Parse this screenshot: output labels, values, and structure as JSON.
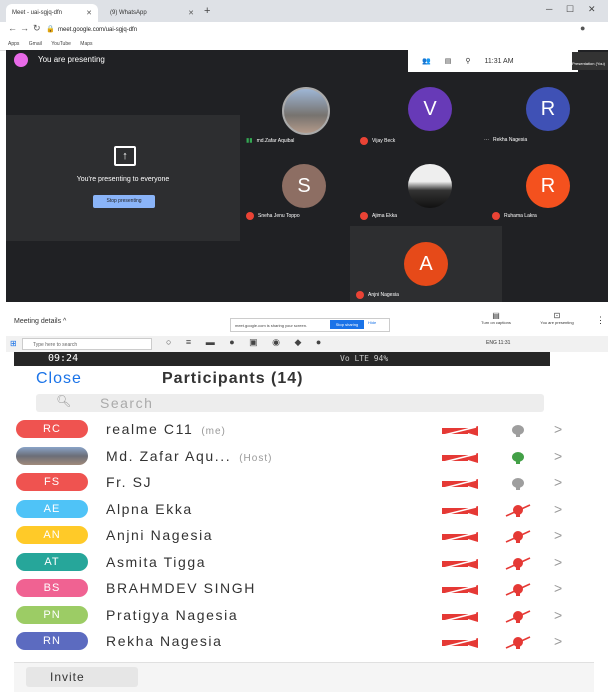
{
  "browser": {
    "tabs": [
      {
        "label": "Meet - uai-sgjq-dfn",
        "active": true
      },
      {
        "label": "(9) WhatsApp",
        "active": false
      }
    ],
    "url": "meet.google.com/uai-sgjq-dfn",
    "bookmarks": [
      "Apps",
      "Gmail",
      "YouTube",
      "Maps"
    ]
  },
  "meet": {
    "presenting_label": "You are presenting",
    "clock": "11:31 AM",
    "presentation_thumb_label": "Presentation (You)",
    "present_panel_text": "You're presenting to everyone",
    "stop_presenting_label": "Stop presenting",
    "tiles": [
      {
        "name": "md.Zafar Aquibal",
        "initial": "",
        "color": "#6f6f6f",
        "photo": true,
        "mic": "speaking"
      },
      {
        "name": "Vijay Beck",
        "initial": "V",
        "color": "#673ab7",
        "mic": "muted"
      },
      {
        "name": "Rekha Nagesia",
        "initial": "R",
        "color": "#3f51b5",
        "mic": "dots"
      },
      {
        "name": "Sneha Jenu Toppo",
        "initial": "S",
        "color": "#8d6e63",
        "mic": "muted"
      },
      {
        "name": "Ajima Ekka",
        "initial": "",
        "color": "#444",
        "photo": true,
        "mic": "muted"
      },
      {
        "name": "Ruhama Lakra",
        "initial": "R",
        "color": "#f4511e",
        "mic": "muted"
      },
      {
        "name": "Anjni Nagesia",
        "initial": "A",
        "color": "#e64a19",
        "mic": "muted"
      }
    ],
    "meeting_details_label": "Meeting details",
    "sharing_text": "meet.google.com is sharing your screen.",
    "stop_sharing_label": "Stop sharing",
    "hide_label": "Hide",
    "captions_label": "Turn on captions",
    "you_presenting_label": "You are presenting"
  },
  "taskbar": {
    "search_placeholder": "Type here to search",
    "tray_time": "11:31",
    "tray_lang": "ENG"
  },
  "phone": {
    "status_time": "09:24",
    "status_right": "Vo LTE 94%",
    "close_label": "Close",
    "title": "Participants (14)",
    "search_placeholder": "Search",
    "invite_label": "Invite",
    "participants": [
      {
        "initials": "RC",
        "color": "#ef5350",
        "name": "realme C11",
        "suffix": "(me)",
        "mic": "on-gray"
      },
      {
        "initials": "",
        "color": "",
        "photo": true,
        "name": "Md. Zafar Aqu...",
        "suffix": "(Host)",
        "mic": "on-green"
      },
      {
        "initials": "FS",
        "color": "#ef5350",
        "name": "Fr. SJ",
        "suffix": "",
        "mic": "on-gray"
      },
      {
        "initials": "AE",
        "color": "#4fc3f7",
        "name": "Alpna Ekka",
        "suffix": "",
        "mic": "muted"
      },
      {
        "initials": "AN",
        "color": "#ffca28",
        "name": "Anjni Nagesia",
        "suffix": "",
        "mic": "muted"
      },
      {
        "initials": "AT",
        "color": "#26a69a",
        "name": "Asmita Tigga",
        "suffix": "",
        "mic": "muted"
      },
      {
        "initials": "BS",
        "color": "#f06292",
        "name": "BRAHMDEV SINGH",
        "suffix": "",
        "mic": "muted"
      },
      {
        "initials": "PN",
        "color": "#9ccc65",
        "name": "Pratigya Nagesia",
        "suffix": "",
        "mic": "muted"
      },
      {
        "initials": "RN",
        "color": "#5c6bc0",
        "name": "Rekha Nagesia",
        "suffix": "",
        "mic": "muted"
      }
    ]
  },
  "colors": {
    "meet_bg": "#202124",
    "accent_blue": "#1a73e8",
    "muted_red": "#e53935"
  }
}
